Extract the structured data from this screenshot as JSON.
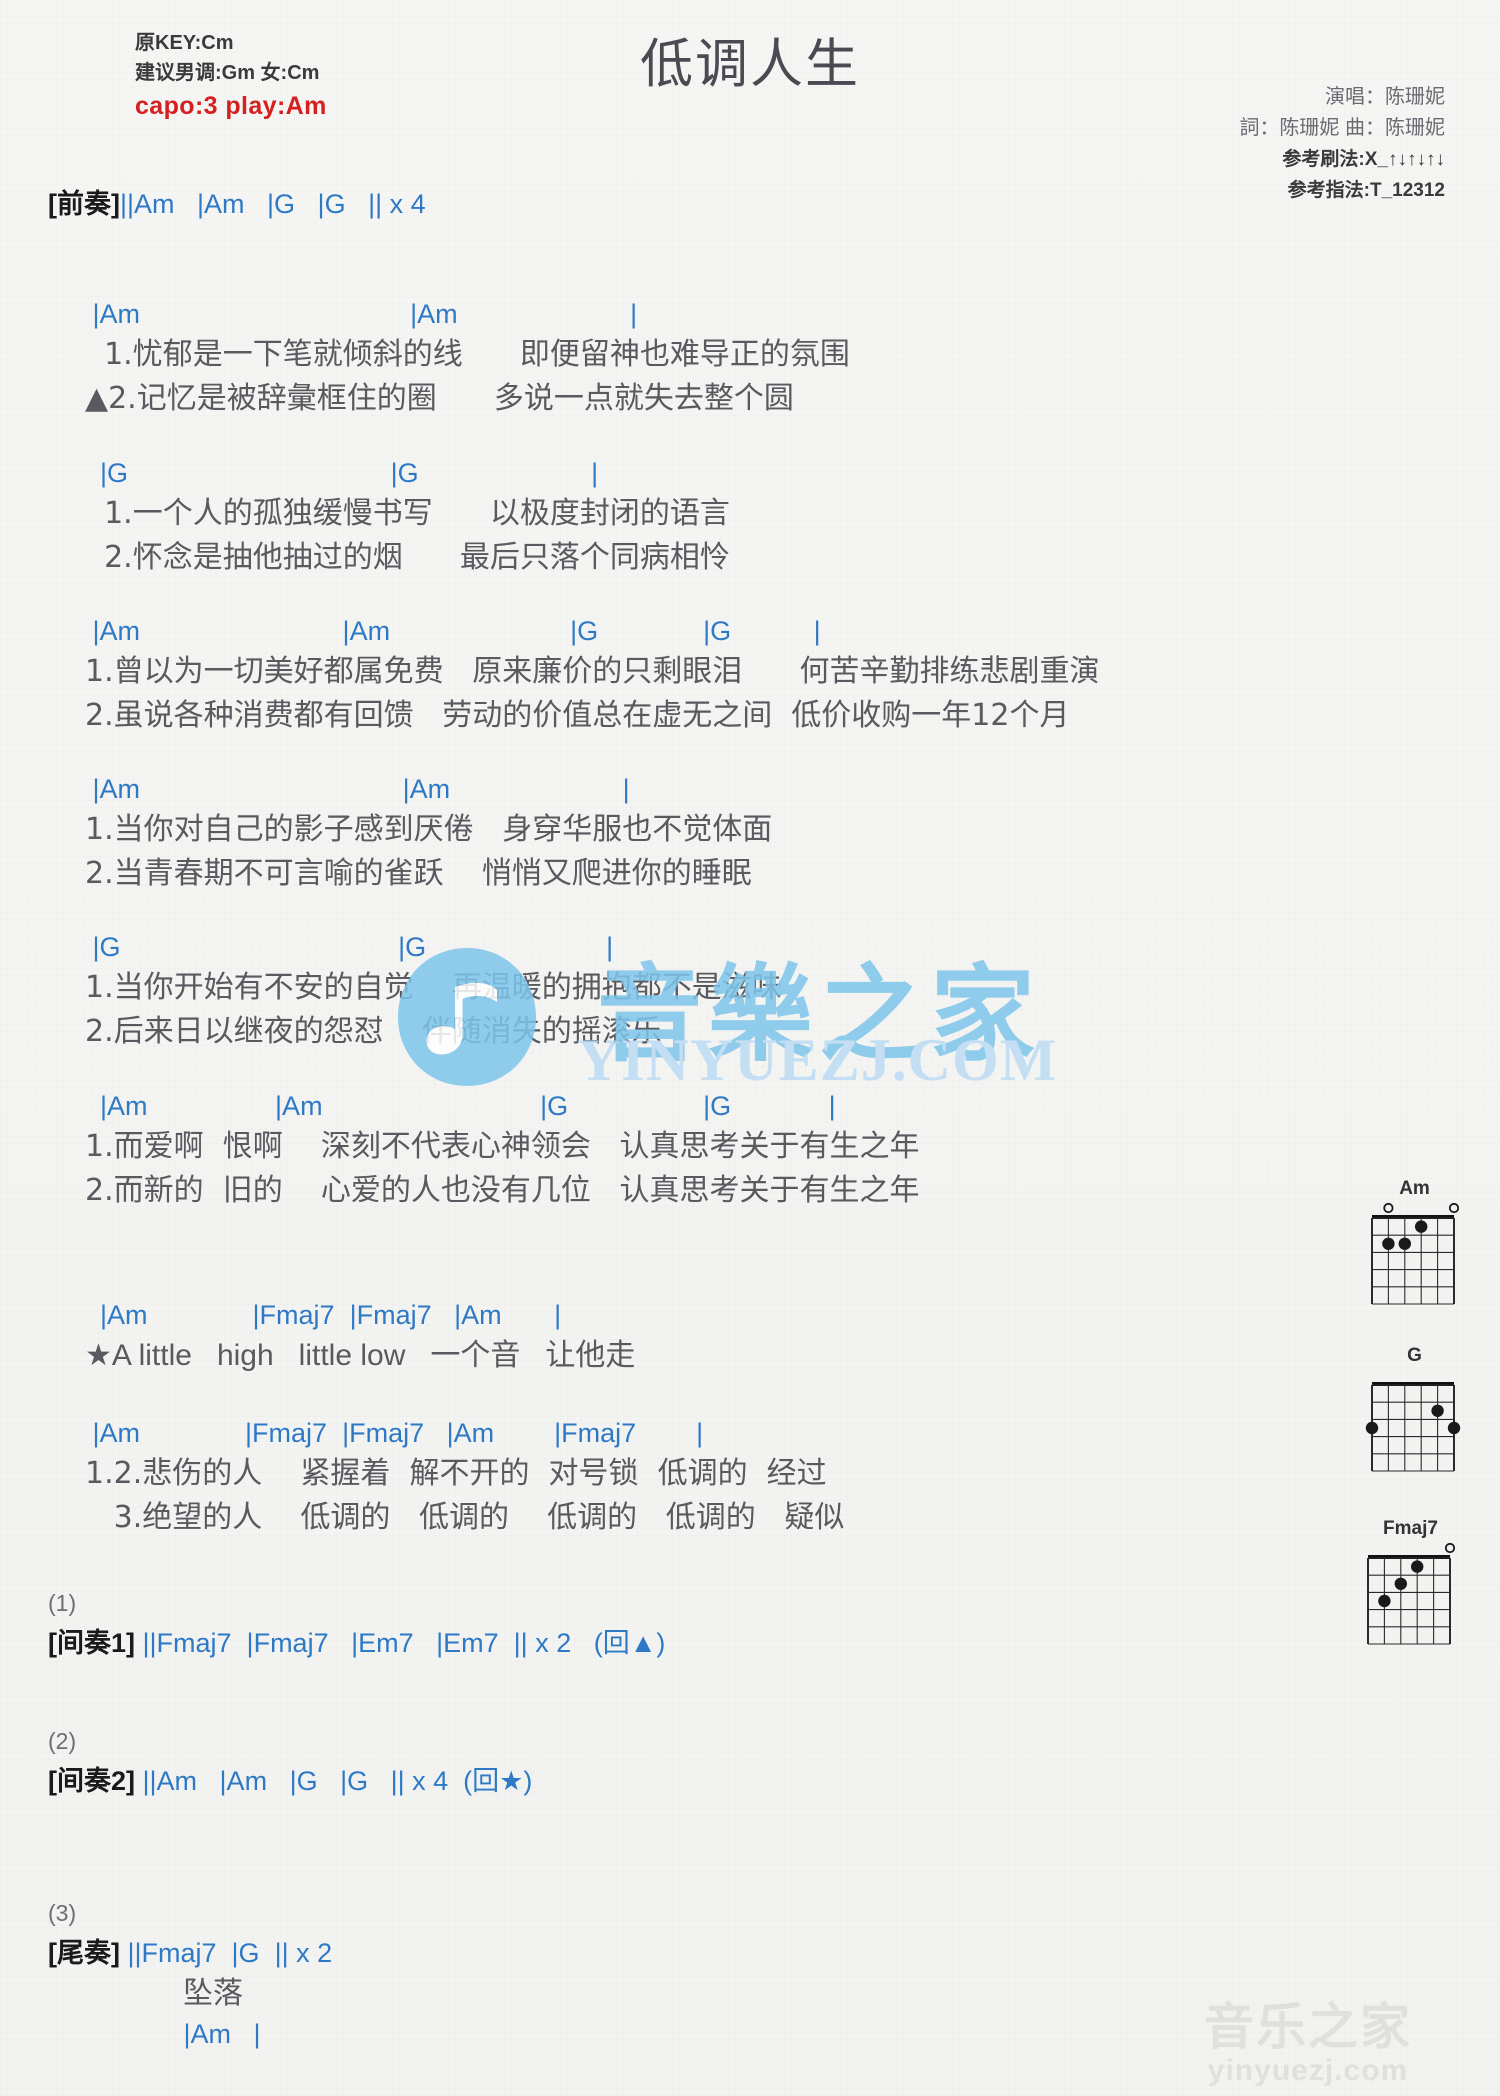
{
  "header": {
    "orig_key": "原KEY:Cm",
    "suggest_key": "建议男调:Gm 女:Cm",
    "capo": "capo:3 play:Am",
    "title": "低调人生",
    "singer": "演唱：陈珊妮",
    "credits": "詞：陈珊妮  曲：陈珊妮",
    "strum": "参考刷法:X_↑↓↑↓↑↓",
    "picking": "参考指法:T_12312",
    "capo_color": "#d52020",
    "chord_color": "#2e79c6"
  },
  "intro": {
    "label": "[前奏]",
    "line": "||Am   |Am   |G   |G   || x 4"
  },
  "blocks": [
    {
      "chords": " |Am                                    |Am                       |",
      "lyrics": [
        "  1.忧郁是一下笔就倾斜的线      即便留神也难导正的氛围",
        "▲2.记忆是被辞彙框住的圈      多说一点就失去整个圆"
      ]
    },
    {
      "chords": "  |G                                   |G                       |",
      "lyrics": [
        "  1.一个人的孤独缓慢书写      以极度封闭的语言",
        "  2.怀念是抽他抽过的烟      最后只落个同病相怜"
      ]
    },
    {
      "chords": " |Am                           |Am                        |G              |G           |",
      "lyrics": [
        "1.曾以为一切美好都属免费   原来廉价的只剩眼泪      何苦辛勤排练悲剧重演",
        "2.虽说各种消费都有回馈   劳动的价值总在虚无之间  低价收购一年12个月"
      ]
    },
    {
      "chords": " |Am                                   |Am                       |",
      "lyrics": [
        "1.当你对自己的影子感到厌倦   身穿华服也不觉体面",
        "2.当青春期不可言喻的雀跃    悄悄又爬进你的睡眠"
      ]
    },
    {
      "chords": " |G                                     |G                        |",
      "lyrics": [
        "1.当你开始有不安的自觉    再温暖的拥抱都不是滋味",
        "2.后来日以继夜的怨怼    伴随消失的摇滚乐"
      ]
    },
    {
      "chords": "  |Am                 |Am                             |G                  |G             |",
      "lyrics": [
        "1.而爱啊  恨啊    深刻不代表心神领会   认真思考关于有生之年",
        "2.而新的  旧的    心爱的人也没有几位   认真思考关于有生之年"
      ]
    }
  ],
  "chorus": [
    {
      "chords": "  |Am              |Fmaj7  |Fmaj7   |Am       |",
      "lyrics": [
        "★A little   high   little low   一个音   让他走"
      ]
    },
    {
      "chords": " |Am              |Fmaj7  |Fmaj7   |Am        |Fmaj7        |",
      "lyrics": [
        "1.2.悲伤的人    紧握着  解不开的  对号锁  低调的  经过",
        "   3.绝望的人    低调的   低调的    低调的   低调的   疑似"
      ]
    }
  ],
  "endings": [
    {
      "num": "(1)",
      "label": "[间奏1]",
      "line": "||Fmaj7  |Fmaj7   |Em7   |Em7  || x 2   (回▲)"
    },
    {
      "num": "(2)",
      "label": "[间奏2]",
      "line": "||Am   |Am   |G   |G   || x 4  (回★)"
    },
    {
      "num": "(3)",
      "label": "[尾奏]",
      "line": "||Fmaj7  |G  || x 2",
      "outro_lyric": "坠落",
      "outro_chord": " |Am   |"
    }
  ],
  "watermark": {
    "center_text": "YINYUEZJ.COM",
    "center_cjk": "音樂之家",
    "bottom_cjk": "音乐之家",
    "bottom_url": "yinyuezj.com"
  },
  "diagrams": [
    {
      "name": "Am",
      "open": [
        false,
        true,
        false,
        false,
        false,
        true
      ],
      "muted": [
        false,
        false,
        false,
        false,
        false,
        false
      ],
      "dots": [
        {
          "string": 2,
          "fret": 2
        },
        {
          "string": 3,
          "fret": 2
        },
        {
          "string": 4,
          "fret": 1
        }
      ]
    },
    {
      "name": "G",
      "open": [
        false,
        false,
        false,
        false,
        false,
        false
      ],
      "muted": [
        false,
        false,
        false,
        false,
        false,
        false
      ],
      "dots": [
        {
          "string": 1,
          "fret": 3
        },
        {
          "string": 5,
          "fret": 2
        },
        {
          "string": 6,
          "fret": 3
        }
      ]
    },
    {
      "name": "Fmaj7",
      "open": [
        false,
        false,
        false,
        false,
        false,
        true
      ],
      "muted": [
        false,
        false,
        false,
        false,
        false,
        false
      ],
      "dots": [
        {
          "string": 2,
          "fret": 3
        },
        {
          "string": 3,
          "fret": 2
        },
        {
          "string": 4,
          "fret": 1
        }
      ]
    }
  ]
}
